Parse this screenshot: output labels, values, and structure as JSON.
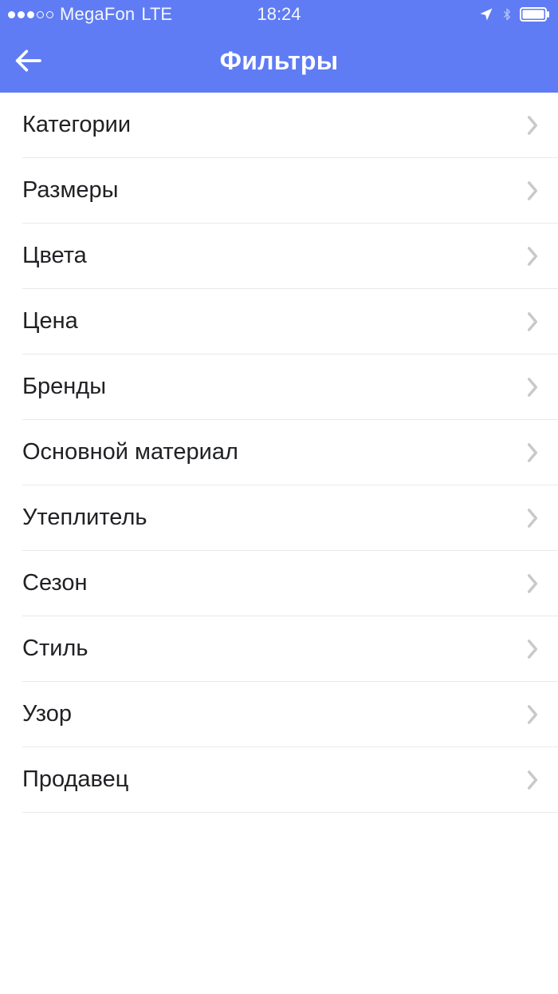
{
  "status": {
    "carrier": "MegaFon",
    "network": "LTE",
    "time": "18:24"
  },
  "nav": {
    "title": "Фильтры"
  },
  "filters": {
    "items": [
      {
        "label": "Категории"
      },
      {
        "label": "Размеры"
      },
      {
        "label": "Цвета"
      },
      {
        "label": "Цена"
      },
      {
        "label": "Бренды"
      },
      {
        "label": "Основной материал"
      },
      {
        "label": "Утеплитель"
      },
      {
        "label": "Сезон"
      },
      {
        "label": "Стиль"
      },
      {
        "label": "Узор"
      },
      {
        "label": "Продавец"
      }
    ]
  },
  "colors": {
    "accent": "#5f7cf4",
    "text": "#202124",
    "chevron": "#c9c9cc",
    "divider": "#e9e9ea"
  }
}
